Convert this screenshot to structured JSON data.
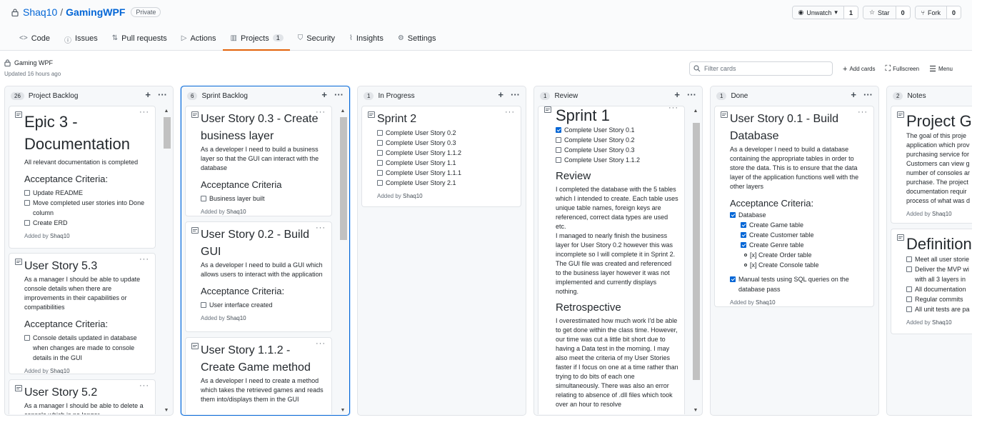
{
  "repo": {
    "owner": "Shaq10",
    "separator": "/",
    "name": "GamingWPF",
    "visibility": "Private",
    "watch": {
      "label": "Unwatch",
      "count": "1"
    },
    "star": {
      "label": "Star",
      "count": "0"
    },
    "fork": {
      "label": "Fork",
      "count": "0"
    }
  },
  "tabs": [
    {
      "label": "Code",
      "icon": "code-icon"
    },
    {
      "label": "Issues",
      "icon": "issue-icon"
    },
    {
      "label": "Pull requests",
      "icon": "pull-request-icon"
    },
    {
      "label": "Actions",
      "icon": "play-icon"
    },
    {
      "label": "Projects",
      "icon": "project-icon",
      "count": "1",
      "selected": true
    },
    {
      "label": "Security",
      "icon": "shield-icon"
    },
    {
      "label": "Insights",
      "icon": "graph-icon"
    },
    {
      "label": "Settings",
      "icon": "gear-icon"
    }
  ],
  "project": {
    "name": "Gaming WPF",
    "updated": "Updated 16 hours ago",
    "filter_placeholder": "Filter cards",
    "add_cards": "Add cards",
    "fullscreen": "Fullscreen",
    "menu": "Menu"
  },
  "colors": {
    "link": "#0366d6",
    "accent": "#e36209",
    "column_bg": "#f6f8fa",
    "border": "#e1e4e8"
  },
  "columns": [
    {
      "count": "26",
      "name": "Project Backlog",
      "cards": [
        {
          "title": "Epic 3 - Documentation",
          "text": "All relevant documentation is completed",
          "criteria_heading": "Acceptance Criteria:",
          "items": [
            "Update README",
            "Move completed user stories into Done column",
            "Create ERD"
          ],
          "added_prefix": "Added by",
          "added_by": "Shaq10"
        },
        {
          "title": "User Story 5.3",
          "text": "As a manager I should be able to update console details when there are improvements in their capabilities or compatibilities",
          "criteria_heading": "Acceptance Criteria:",
          "items": [
            "Console details updated in database when changes are made to console details in the GUI"
          ],
          "added_prefix": "Added by",
          "added_by": "Shaq10"
        },
        {
          "title": "User Story 5.2",
          "text": "As a manager I should be able to delete a console which is no longer"
        }
      ]
    },
    {
      "count": "6",
      "name": "Sprint Backlog",
      "cards": [
        {
          "title": "User Story 0.3 - Create business layer",
          "text": "As a developer I need to build a business layer so that the GUI can interact with the database",
          "criteria_heading": "Acceptance Criteria",
          "items": [
            "Business layer built"
          ],
          "added_prefix": "Added by",
          "added_by": "Shaq10"
        },
        {
          "title": "User Story 0.2 - Build GUI",
          "text": "As a developer I need to build a GUI which allows users to interact with the application",
          "criteria_heading": "Acceptance Criteria:",
          "items": [
            "User interface created"
          ],
          "added_prefix": "Added by",
          "added_by": "Shaq10"
        },
        {
          "title": "User Story 1.1.2 - Create Game method",
          "text": "As a developer I need to create a method which takes the retrieved games and reads them into/displays them in the GUI"
        }
      ]
    },
    {
      "count": "1",
      "name": "In Progress",
      "cards": [
        {
          "title": "Sprint 2",
          "items": [
            "Complete User Story 0.2",
            "Complete User Story 0.3",
            "Complete User Story 1.1.2",
            "Complete User Story 1.1",
            "Complete User Story 1.1.1",
            "Complete User Story 2.1"
          ],
          "added_prefix": "Added by",
          "added_by": "Shaq10"
        }
      ]
    },
    {
      "count": "1",
      "name": "Review",
      "cards": [
        {
          "title": "Sprint 1",
          "items": [
            "Complete User Story 0.1",
            "Complete User Story 0.2",
            "Complete User Story 0.3",
            "Complete User Story 1.1.2"
          ],
          "checked": [
            true,
            false,
            false,
            false
          ],
          "review_heading": "Review",
          "review_text_1": "I completed the database with the 5 tables which I intended to create. Each table uses unique table names, foreign keys are referenced, correct data types are used etc.",
          "review_text_2": "I managed to nearly finish the business layer for User Story 0.2 however this was incomplete so I will complete it in Sprint 2. The GUI file was created and referenced to the business layer however it was not implemented and currently displays nothing.",
          "retro_heading": "Retrospective",
          "retro_text": "I overestimated how much work I'd be able to get done within the class time. However, our time was cut a little bit short due to having a Data test in the morning. I may also meet the criteria of my User Stories faster if I focus on one at a time rather than trying to do bits of each one simultaneously. There was also an error relating to absence of .dll files which took over an hour to resolve"
        }
      ]
    },
    {
      "count": "1",
      "name": "Done",
      "cards": [
        {
          "title": "User Story 0.1 - Build Database",
          "text": "As a developer I need to build a database containing the appropriate tables in order to store the data. This is to ensure that the data layer of the application functions well with the other layers",
          "criteria_heading": "Acceptance Criteria:",
          "item_database": "Database",
          "sub_items": [
            "Create Game table",
            "Create Customer table",
            "Create Genre table"
          ],
          "bullet_items": [
            "[x] Create Order table",
            "[x] Create Console table"
          ],
          "item_tests": "Manual tests using SQL queries on the database pass",
          "added_prefix": "Added by",
          "added_by": "Shaq10"
        }
      ]
    },
    {
      "count": "2",
      "name": "Notes",
      "cards": [
        {
          "title": "Project Go",
          "text": "The goal of this proje application which prov purchasing service for Customers can view g number of consoles ar purchase. The project documentation requir process of what was d",
          "added_prefix": "Added by",
          "added_by": "Shaq10"
        },
        {
          "title": "Definition",
          "items": [
            "Meet all user storie",
            "Deliver the MVP wi with all 3 layers in",
            "All documentation",
            "Regular commits",
            "All unit tests are pa"
          ],
          "added_prefix": "Added by",
          "added_by": "Shaq10"
        }
      ]
    }
  ]
}
